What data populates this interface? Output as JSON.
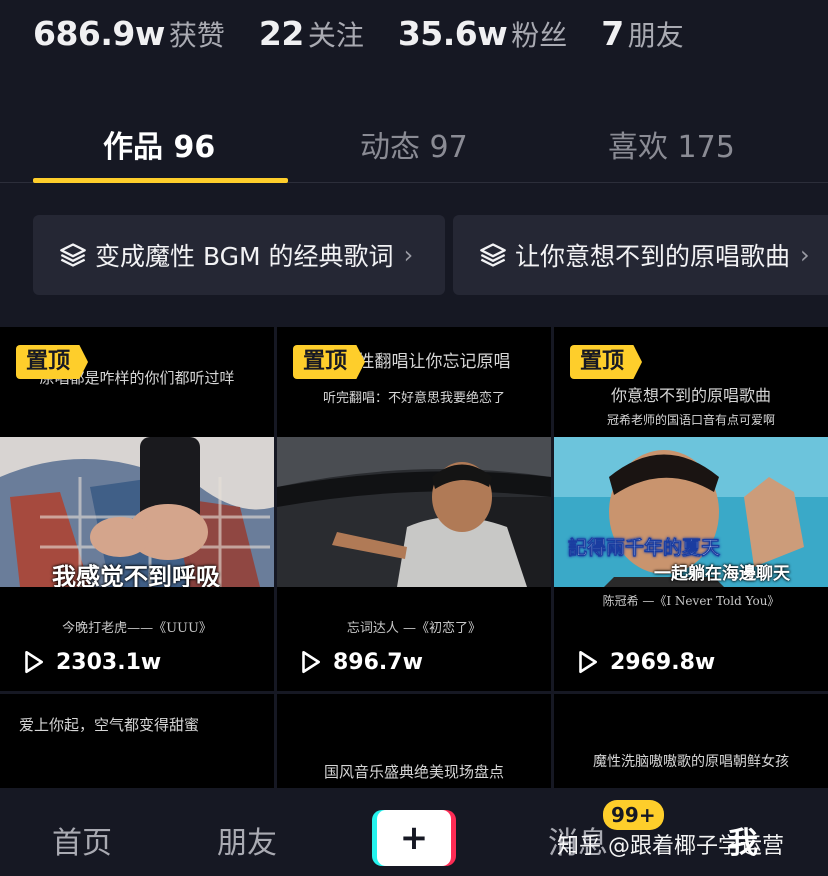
{
  "stats": [
    {
      "num": "686.9w",
      "label": "获赞"
    },
    {
      "num": "22",
      "label": "关注"
    },
    {
      "num": "35.6w",
      "label": "粉丝"
    },
    {
      "num": "7",
      "label": "朋友"
    }
  ],
  "tabs": [
    {
      "label": "作品 96"
    },
    {
      "label": "动态 97"
    },
    {
      "label": "喜欢 175"
    }
  ],
  "collections": [
    {
      "label": "变成魔性 BGM 的经典歌词",
      "chevron": "›",
      "icon": "stack-icon"
    },
    {
      "label": "让你意想不到的原唱歌曲",
      "chevron": "›",
      "icon": "stack-icon"
    }
  ],
  "pin_label": "置顶",
  "videos": [
    {
      "top_caption": "原唱都是咋样的你们都听过咩",
      "top_caption2": "",
      "subtitle": "我感觉不到呼吸",
      "subtitle2": "",
      "bottom_caption": "今晚打老虎——《UUU》",
      "plays": "2303.1w",
      "pinned": true
    },
    {
      "top_caption": "性翻唱让你忘记原唱",
      "top_caption2": "听完翻唱：不好意思我要绝恋了",
      "subtitle": "",
      "subtitle2": "",
      "bottom_caption": "忘词达人 —《初恋了》",
      "plays": "896.7w",
      "pinned": true
    },
    {
      "top_caption": "你意想不到的原唱歌曲",
      "top_caption2": "冠希老师的国语口音有点可爱啊",
      "subtitle": "記得兩千年的夏天",
      "subtitle2": "一起躺在海邊聊天",
      "bottom_caption": "陈冠希 —《I Never Told You》",
      "plays": "2969.8w",
      "pinned": true
    },
    {
      "top_caption": "爱上你起，空气都变得甜蜜"
    },
    {
      "top_caption": "国风音乐盛典绝美现场盘点"
    },
    {
      "top_caption": "魔性洗脑嗷嗷歌的原唱朝鲜女孩"
    }
  ],
  "nav": {
    "home": "首页",
    "friends": "朋友",
    "plus": "+",
    "messages": "消息",
    "messages_badge": "99+",
    "me": "我"
  },
  "watermark": "知乎 @跟着椰子学运营",
  "colors": {
    "background": "#161823",
    "accent": "#fece2b",
    "tiktok_cyan": "#25f4ee",
    "tiktok_red": "#fe2c55"
  }
}
